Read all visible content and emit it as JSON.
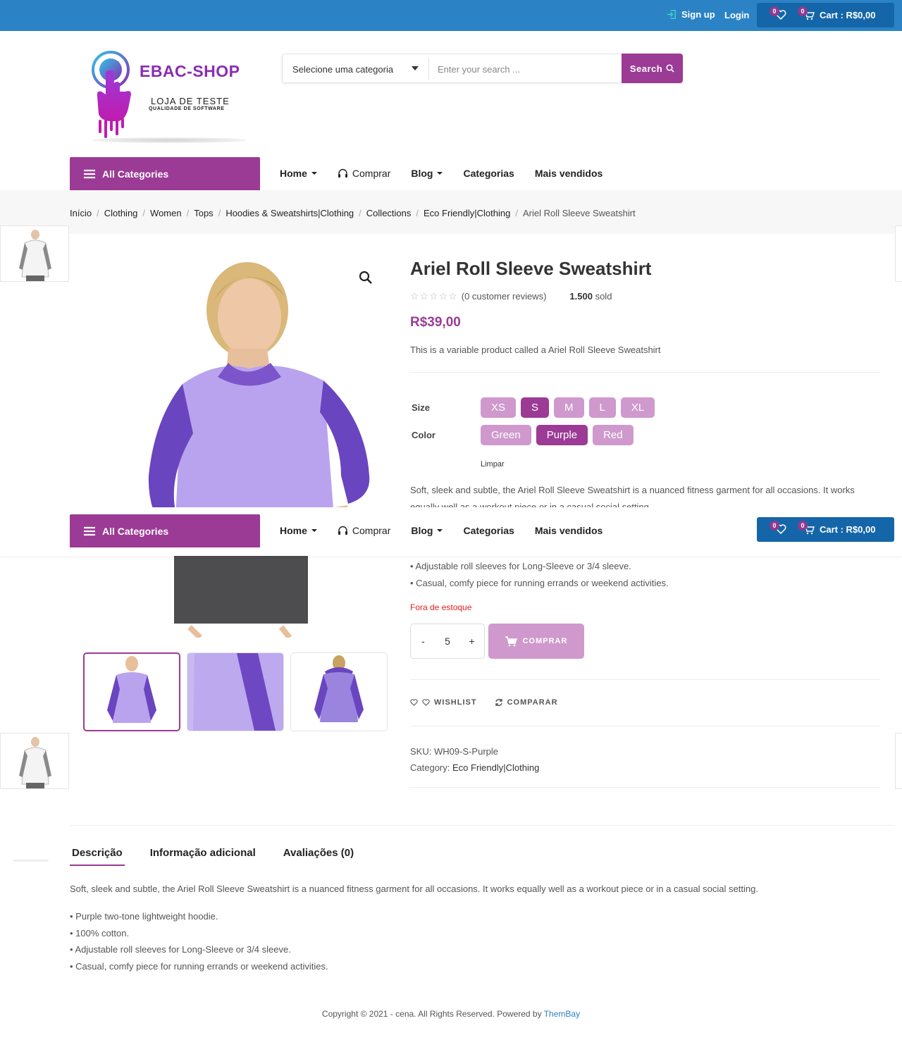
{
  "topbar": {
    "signup": "Sign up",
    "login": "Login",
    "wishlist_count": "0",
    "cart_count": "0",
    "cart_label": "Cart : R$0,00"
  },
  "logo": {
    "brand": "EBAC-SHOP",
    "tagline": "LOJA DE TESTE",
    "subtagline": "QUALIDADE DE SOFTWARE"
  },
  "search": {
    "category": "Selecione uma categoria",
    "placeholder": "Enter your search ...",
    "button": "Search"
  },
  "nav": {
    "all_categories": "All Categories",
    "items": [
      "Home",
      "Comprar",
      "Blog",
      "Categorias",
      "Mais vendidos"
    ]
  },
  "breadcrumb": [
    "Início",
    "Clothing",
    "Women",
    "Tops",
    "Hoodies & Sweatshirts|Clothing",
    "Collections",
    "Eco Friendly|Clothing",
    "Ariel Roll Sleeve Sweatshirt"
  ],
  "product": {
    "title": "Ariel Roll Sleeve Sweatshirt",
    "reviews": "(0 customer reviews)",
    "sold_count": "1.500",
    "sold_label": "sold",
    "price": "R$39,00",
    "short_description": "This is a variable product called a Ariel Roll Sleeve Sweatshirt",
    "size_label": "Size",
    "sizes": [
      "XS",
      "S",
      "M",
      "L",
      "XL"
    ],
    "selected_size": "S",
    "color_label": "Color",
    "colors": [
      "Green",
      "Purple",
      "Red"
    ],
    "selected_color": "Purple",
    "clear": "Limpar",
    "long_description": "Soft, sleek and subtle, the Ariel Roll Sleeve Sweatshirt is a nuanced fitness garment for all occasions. It works equally well as a workout piece or in a casual social setting.",
    "bullets_visible": [
      "• Adjustable roll sleeves for Long-Sleeve or 3/4 sleeve.",
      "• Casual, comfy piece for running errands or weekend activities."
    ],
    "stock_status": "Fora de estoque",
    "qty_minus": "-",
    "qty_value": "5",
    "qty_plus": "+",
    "buy_button": "COMPRAR",
    "wishlist": "WISHLIST",
    "compare": "COMPARAR",
    "sku_label": "SKU:",
    "sku": "WH09-S-Purple",
    "category_label": "Category:",
    "category": "Eco Friendly|Clothing"
  },
  "tabs": {
    "items": [
      "Descrição",
      "Informação adicional",
      "Avaliações (0)"
    ],
    "active": "Descrição",
    "description": "Soft, sleek and subtle, the Ariel Roll Sleeve Sweatshirt is a nuanced fitness garment for all occasions. It works equally well as a workout piece or in a casual social setting.",
    "bullets": [
      "• Purple two-tone lightweight hoodie.",
      "• 100% cotton.",
      "• Adjustable roll sleeves for Long-Sleeve or 3/4 sleeve.",
      "• Casual, comfy piece for running errands or weekend activities."
    ]
  },
  "footer": {
    "copyright": "Copyright © 2021 - cena. All Rights Reserved. Powered by",
    "powered": "ThemBay"
  },
  "colors": {
    "topbar": "#2b83c5",
    "cart": "#1466a9",
    "accent": "#9b3b95",
    "swatch": "#cf99cd",
    "stock": "#e12020"
  }
}
